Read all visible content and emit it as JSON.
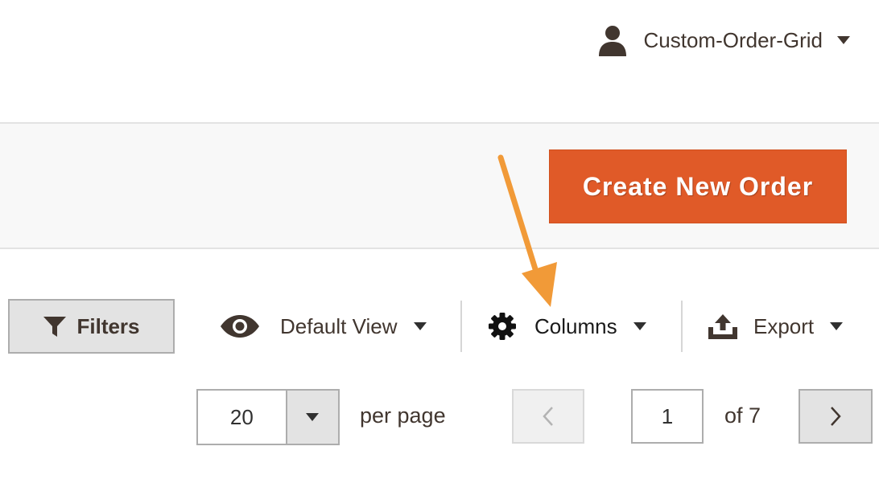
{
  "header": {
    "account": {
      "name": "Custom-Order-Grid",
      "icon": "user-icon"
    }
  },
  "page_actions": {
    "create_button_label": "Create New Order",
    "create_button_color": "#e05a28"
  },
  "annotation": {
    "arrow_color": "#f19a38"
  },
  "toolbar": {
    "filters_label": "Filters",
    "view_label": "Default View",
    "columns_label": "Columns",
    "export_label": "Export"
  },
  "pagination": {
    "per_page_value": "20",
    "per_page_label": "per page",
    "current_page": "1",
    "total_label": "of 7"
  }
}
